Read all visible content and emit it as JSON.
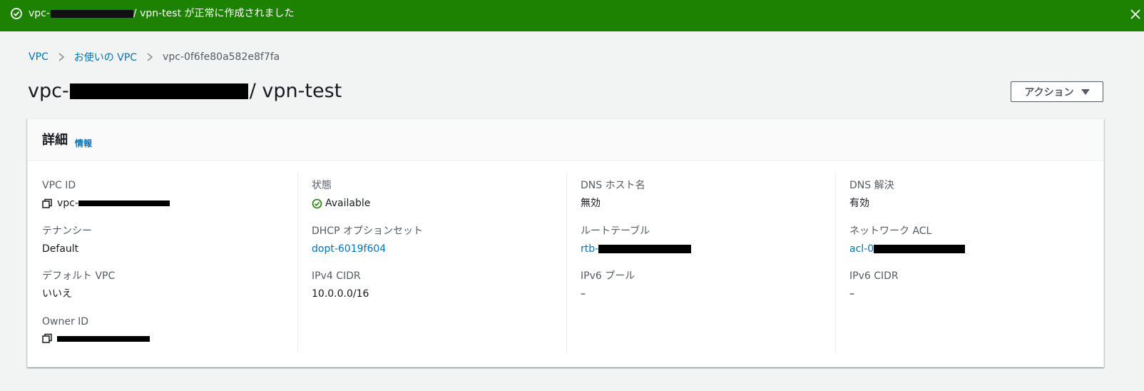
{
  "flash": {
    "prefix": "vpc-",
    "suffix": "/ vpn-test が正常に作成されました"
  },
  "breadcrumb": {
    "items": [
      "VPC",
      "お使いの VPC"
    ],
    "current": "vpc-0f6fe80a582e8f7fa"
  },
  "header": {
    "title_prefix": "vpc-",
    "title_suffix": "/ vpn-test",
    "action_label": "アクション"
  },
  "details": {
    "title": "詳細",
    "info_label": "情報",
    "vpc_id": {
      "label": "VPC ID",
      "value": "vpc-"
    },
    "tenancy": {
      "label": "テナンシー",
      "value": "Default"
    },
    "default_vpc": {
      "label": "デフォルト VPC",
      "value": "いいえ"
    },
    "owner_id": {
      "label": "Owner ID",
      "value": ""
    },
    "state": {
      "label": "状態",
      "value": "Available"
    },
    "dhcp": {
      "label": "DHCP オプションセット",
      "value": "dopt-6019f604"
    },
    "ipv4": {
      "label": "IPv4 CIDR",
      "value": "10.0.0.0/16"
    },
    "dns_hostnames": {
      "label": "DNS ホスト名",
      "value": "無効"
    },
    "route_table": {
      "label": "ルートテーブル",
      "value": "rtb-"
    },
    "ipv6_pool": {
      "label": "IPv6 プール",
      "value": "–"
    },
    "dns_resolution": {
      "label": "DNS 解決",
      "value": "有効"
    },
    "network_acl": {
      "label": "ネットワーク ACL",
      "value": "acl-0"
    },
    "ipv6_cidr": {
      "label": "IPv6 CIDR",
      "value": "–"
    }
  },
  "colors": {
    "success": "#1d8102",
    "link": "#0073bb",
    "label": "#545b64"
  },
  "icons": [
    "success-circle-icon",
    "close-icon",
    "chevron-right-icon",
    "caret-down-icon",
    "copy-icon",
    "status-ok-icon"
  ]
}
